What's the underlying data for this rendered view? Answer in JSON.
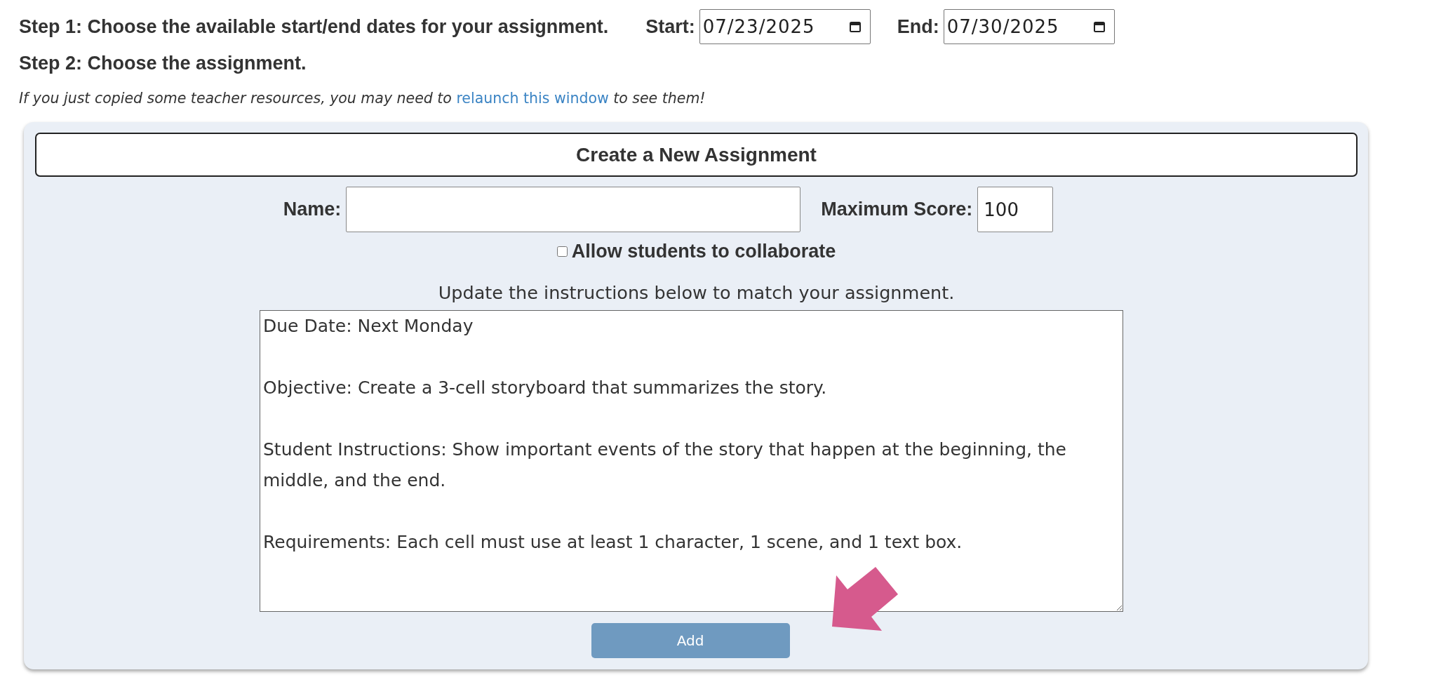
{
  "step1": {
    "label": "Step 1: Choose the available start/end dates for your assignment.",
    "start_label": "Start:",
    "start_value": "07/23/2025",
    "end_label": "End:",
    "end_value": "07/30/2025"
  },
  "step2": {
    "label": "Step 2: Choose the assignment."
  },
  "notice": {
    "before": "If you just copied some teacher resources, you may need to",
    "link": "relaunch this window",
    "after": "to see them!"
  },
  "card": {
    "title": "Create a New Assignment",
    "name_label": "Name:",
    "score_label": "Maximum Score:",
    "score_value": "100",
    "collaborate": {
      "label": "Allow students to collaborate",
      "checked": false
    },
    "instructions_hint": "Update the instructions below to match your assignment.",
    "instructions": "Due Date: Next Monday\n\nObjective: Create a 3-cell storyboard that summarizes the story.\n\nStudent Instructions: Show important events of the story that happen at the beginning, the middle, and the end.\n\nRequirements: Each cell must use at least 1 character, 1 scene, and 1 text box.",
    "button": "Add"
  }
}
